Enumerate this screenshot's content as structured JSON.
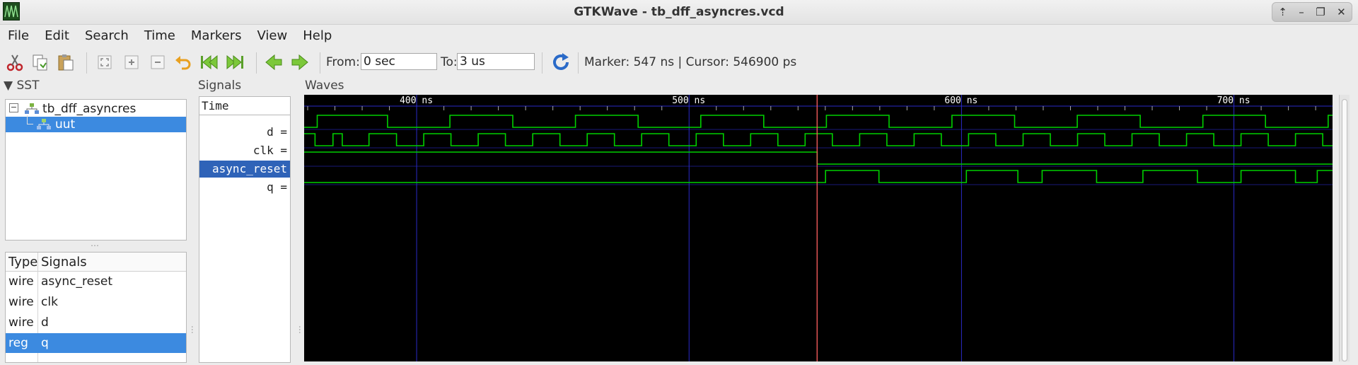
{
  "window": {
    "title": "GTKWave - tb_dff_asyncres.vcd",
    "buttons": [
      "⇡",
      "–",
      "❐",
      "✕"
    ]
  },
  "menu": [
    "File",
    "Edit",
    "Search",
    "Time",
    "Markers",
    "View",
    "Help"
  ],
  "toolbar": {
    "from_label": "From:",
    "from_value": "0 sec",
    "to_label": "To:",
    "to_value": "3 us",
    "status": "Marker: 547 ns  |  Cursor: 546900 ps"
  },
  "sst": {
    "title": "SST",
    "tree": [
      {
        "label": "tb_dff_asyncres"
      },
      {
        "label": "uut"
      }
    ],
    "table": {
      "headers": [
        "Type",
        "Signals"
      ],
      "rows": [
        {
          "type": "wire",
          "name": "async_reset"
        },
        {
          "type": "wire",
          "name": "clk"
        },
        {
          "type": "wire",
          "name": "d"
        },
        {
          "type": "reg",
          "name": "q"
        }
      ]
    }
  },
  "signals_pane": {
    "title": "Signals",
    "time_header": "Time",
    "names": [
      "d =",
      "clk =",
      "async_reset =",
      "q ="
    ],
    "selected_index": 2
  },
  "waves": {
    "title": "Waves",
    "view_start_ns": 358.7,
    "view_end_ns": 736.2,
    "major_ticks": [
      {
        "t": 400,
        "label": "400 ns"
      },
      {
        "t": 500,
        "label": "500 ns"
      },
      {
        "t": 600,
        "label": "600 ns"
      },
      {
        "t": 700,
        "label": "700 ns"
      }
    ],
    "minor_tick_ns": 10,
    "marker_ns": 547,
    "colors": {
      "wave": "#00d000",
      "grid": "#2a2ac8",
      "marker": "#ff6060",
      "ruler_text": "#ffffff"
    },
    "signals": [
      {
        "name": "d",
        "start": 0,
        "edges": [
          363.5,
          389.3,
          412.2,
          435.3,
          458.3,
          481.3,
          504.3,
          527.4,
          550.4,
          573.4,
          596.5,
          619.5,
          642.5,
          665.6,
          688.6,
          711.6,
          734.6
        ]
      },
      {
        "name": "clk",
        "start": 1,
        "edges": [
          362.7,
          369.3,
          372.7,
          382.5,
          392.6,
          402.6,
          412.6,
          422.6,
          432.6,
          442.6,
          452.6,
          462.6,
          472.6,
          482.6,
          492.6,
          502.6,
          512.6,
          522.6,
          532.6,
          542.6,
          552.6,
          562.6,
          572.6,
          582.6,
          592.6,
          602.6,
          612.6,
          622.6,
          632.6,
          642.6,
          652.6,
          662.6,
          672.6,
          682.6,
          692.6,
          702.6,
          712.6,
          722.6,
          732.6
        ]
      },
      {
        "name": "async_reset",
        "start": 1,
        "edges": [
          547
        ]
      },
      {
        "name": "q",
        "start": 0,
        "edges": [
          550.1,
          569.7,
          601.8,
          620.7,
          629.6,
          649.6,
          666.6,
          686.6,
          702.6,
          722.6,
          730.6
        ]
      }
    ]
  },
  "icons": [
    "cut-icon",
    "copy-icon",
    "paste-icon",
    "zoom-fit-icon",
    "zoom-in-icon",
    "zoom-out-icon",
    "undo-zoom-icon",
    "zoom-start-icon",
    "zoom-end-icon",
    "prev-edge-icon",
    "next-edge-icon",
    "reload-icon"
  ]
}
